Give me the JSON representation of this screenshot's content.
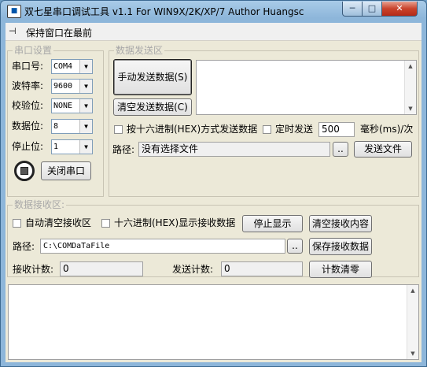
{
  "window": {
    "title": "双七星串口调试工具 v1.1 For WIN9X/2K/XP/7 Author Huangsc",
    "min": "─",
    "max": "□",
    "close": "✕"
  },
  "menu": {
    "keep_top_label": "保持窗口在最前"
  },
  "serial": {
    "legend": "串口设置",
    "port_label": "串口号:",
    "port_value": "COM4",
    "baud_label": "波特率:",
    "baud_value": "9600",
    "parity_label": "校验位:",
    "parity_value": "NONE",
    "data_label": "数据位:",
    "data_value": "8",
    "stop_label": "停止位:",
    "stop_value": "1",
    "close_port_button": "关闭串口"
  },
  "send": {
    "legend": "数据发送区",
    "manual_send_button": "手动发送数据(S)",
    "clear_send_button": "清空发送数据(C)",
    "hex_send_label": "按十六进制(HEX)方式发送数据",
    "timed_send_label": "定时发送",
    "interval_value": "500",
    "interval_unit": "毫秒(ms)/次",
    "path_label": "路径:",
    "path_value": "没有选择文件",
    "browse_button": "..",
    "send_file_button": "发送文件"
  },
  "receive": {
    "legend": "数据接收区:",
    "auto_clear_label": "自动清空接收区",
    "hex_display_label": "十六进制(HEX)显示接收数据",
    "stop_display_button": "停止显示",
    "clear_recv_button": "清空接收内容",
    "path_label": "路径:",
    "path_value": "C:\\COMDaTaFile",
    "browse_button": "..",
    "save_button": "保存接收数据",
    "recv_count_label": "接收计数:",
    "recv_count_value": "0",
    "send_count_label": "发送计数:",
    "send_count_value": "0",
    "count_clear_button": "计数清零"
  },
  "icons": {
    "scroll_up": "▲",
    "scroll_down": "▼",
    "combo_arrow": "▼",
    "pin": "⊣"
  },
  "colors": {
    "titlebar": "#8db6da",
    "client_bg": "#ece9d8",
    "close_btn": "#c9432c"
  }
}
